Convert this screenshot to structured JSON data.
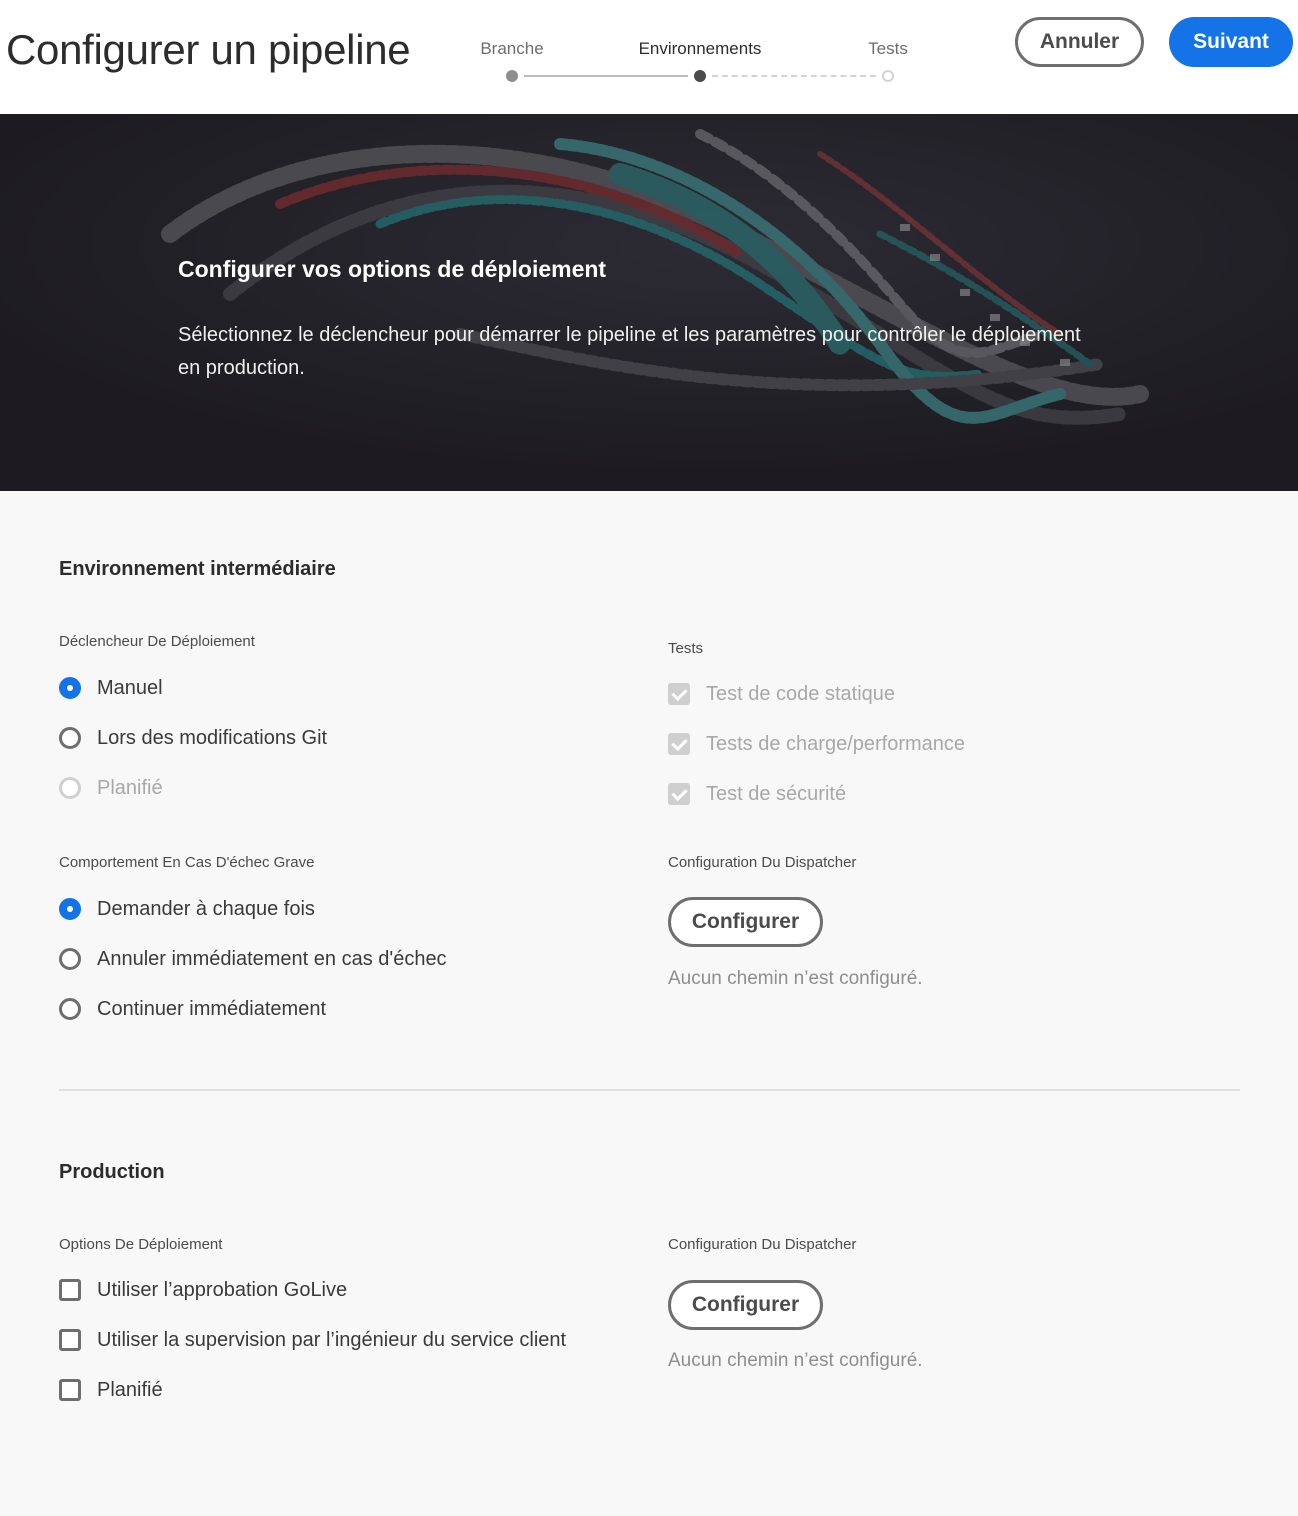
{
  "header": {
    "title": "Configurer un pipeline",
    "steps": [
      {
        "label": "Branche",
        "state": "done"
      },
      {
        "label": "Environnements",
        "state": "active"
      },
      {
        "label": "Tests",
        "state": "todo"
      }
    ],
    "cancel_label": "Annuler",
    "next_label": "Suivant"
  },
  "banner": {
    "title": "Configurer vos options de déploiement",
    "text": "Sélectionnez le déclencheur pour démarrer le pipeline et les paramètres pour contrôler le déploiement en production."
  },
  "staging": {
    "title": "Environnement intermédiaire",
    "trigger": {
      "label": "Déclencheur De Déploiement",
      "options": [
        {
          "label": "Manuel",
          "selected": true,
          "disabled": false
        },
        {
          "label": "Lors des modifications Git",
          "selected": false,
          "disabled": false
        },
        {
          "label": "Planifié",
          "selected": false,
          "disabled": true
        }
      ]
    },
    "failure": {
      "label": "Comportement En Cas D'échec Grave",
      "options": [
        {
          "label": "Demander à chaque fois",
          "selected": true
        },
        {
          "label": "Annuler immédiatement en cas d'échec",
          "selected": false
        },
        {
          "label": "Continuer immédiatement",
          "selected": false
        }
      ]
    },
    "tests": {
      "label": "Tests",
      "options": [
        {
          "label": "Test de code statique",
          "checked": true,
          "disabled": true
        },
        {
          "label": "Tests de charge/performance",
          "checked": true,
          "disabled": true
        },
        {
          "label": "Test de sécurité",
          "checked": true,
          "disabled": true
        }
      ]
    },
    "dispatcher": {
      "label": "Configuration Du Dispatcher",
      "button_label": "Configurer",
      "empty_text": "Aucun chemin n’est configuré."
    }
  },
  "production": {
    "title": "Production",
    "deploy_options": {
      "label": "Options De Déploiement",
      "options": [
        {
          "label": "Utiliser l’approbation GoLive",
          "checked": false
        },
        {
          "label": "Utiliser la supervision par l’ingénieur du service client",
          "checked": false
        },
        {
          "label": "Planifié",
          "checked": false
        }
      ]
    },
    "dispatcher": {
      "label": "Configuration Du Dispatcher",
      "button_label": "Configurer",
      "empty_text": "Aucun chemin n’est configuré."
    }
  },
  "colors": {
    "accent": "#1473e6",
    "banner_bg": "#26252b",
    "page_bg": "#f8f8f8"
  }
}
